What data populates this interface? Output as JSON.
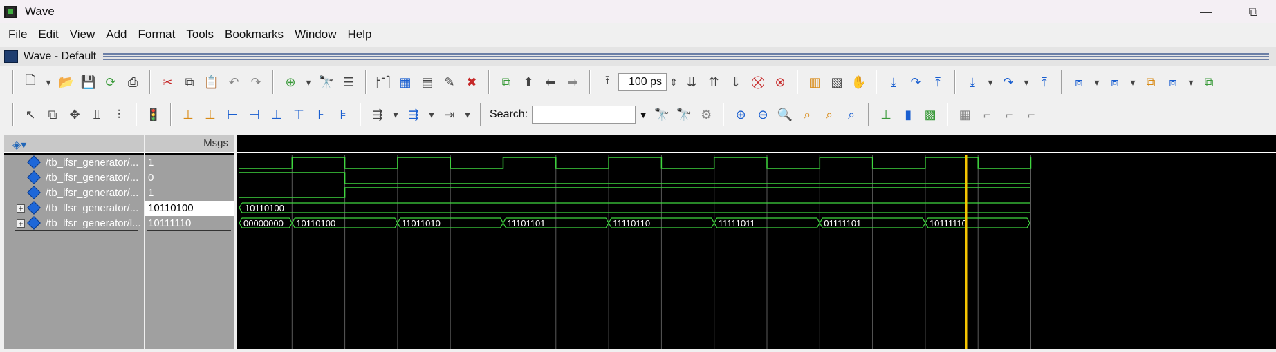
{
  "window": {
    "title": "Wave",
    "minimize": "—",
    "restore": "⧉"
  },
  "menubar": [
    "File",
    "Edit",
    "View",
    "Add",
    "Format",
    "Tools",
    "Bookmarks",
    "Window",
    "Help"
  ],
  "subwindow": {
    "title": "Wave - Default"
  },
  "toolbar": {
    "time_step": "100 ps",
    "search_label": "Search:",
    "search_value": ""
  },
  "columns": {
    "msgs_header": "Msgs"
  },
  "signals": [
    {
      "name": "/tb_lfsr_generator/...",
      "value": "1",
      "expandable": false
    },
    {
      "name": "/tb_lfsr_generator/...",
      "value": "0",
      "expandable": false
    },
    {
      "name": "/tb_lfsr_generator/...",
      "value": "1",
      "expandable": false
    },
    {
      "name": "/tb_lfsr_generator/...",
      "value": "10110100",
      "expandable": true,
      "selected": true
    },
    {
      "name": "/tb_lfsr_generator/l...",
      "value": "10111110",
      "expandable": true
    }
  ],
  "waves": {
    "bus_constant_label": "10110100",
    "bus_segments": [
      "00000000",
      "10110100",
      "11011010",
      "11101101",
      "11110110",
      "11111011",
      "01111101",
      "10111110"
    ]
  },
  "colors": {
    "wave_green": "#3fd63f",
    "grid": "#5a5a5a",
    "cursor": "#f5c400",
    "background": "#000000"
  }
}
